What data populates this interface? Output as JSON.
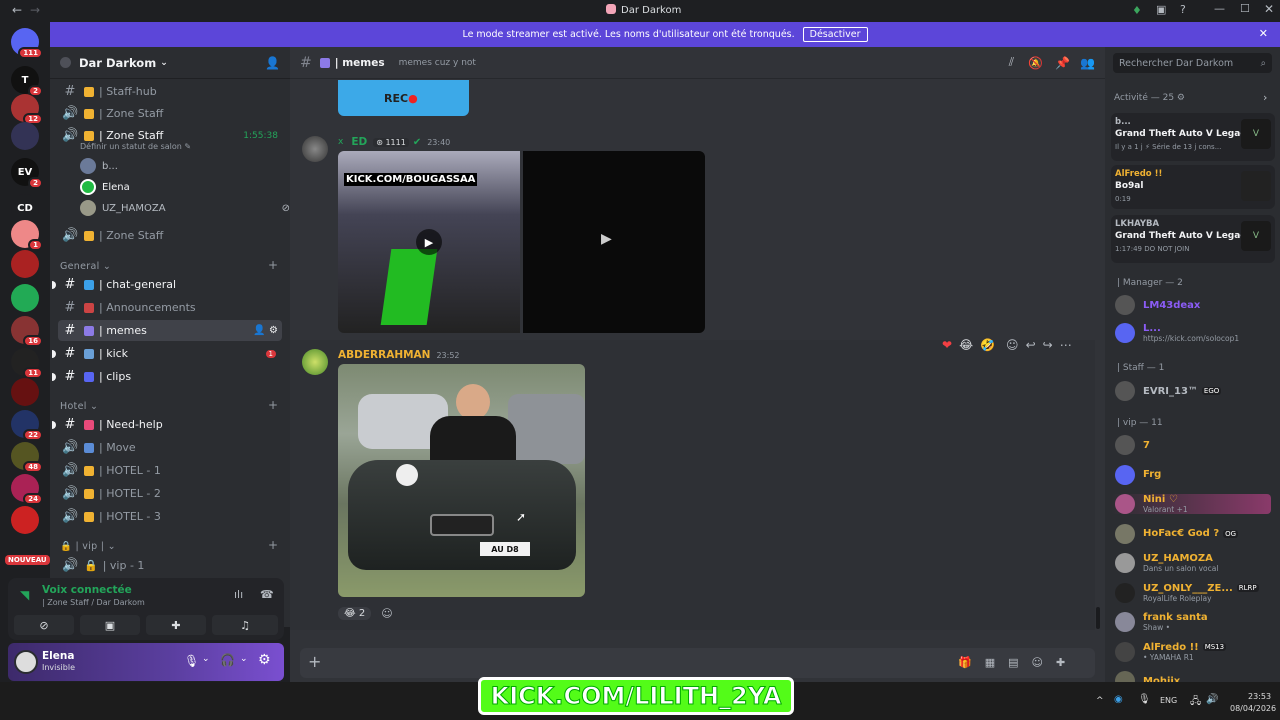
{
  "window": {
    "title": "Dar Darkom"
  },
  "banner": {
    "text": "Le mode streamer est activé. Les noms d'utilisateur ont été tronqués.",
    "button": "Désactiver"
  },
  "guilds": [
    {
      "label": "",
      "badge": "111",
      "color": "#5865f2"
    },
    {
      "label": "T",
      "badge": "2",
      "color": "#111"
    },
    {
      "label": "",
      "badge": "12",
      "color": "#a33"
    },
    {
      "label": "",
      "badge": "",
      "color": "#335"
    },
    {
      "label": "EV",
      "badge": "2",
      "color": "#111"
    },
    {
      "label": "CD",
      "badge": "",
      "color": "#1e1f22"
    },
    {
      "label": "",
      "badge": "1",
      "color": "#e88"
    },
    {
      "label": "",
      "badge": "",
      "color": "#a22"
    },
    {
      "label": "",
      "badge": "",
      "color": "#2a5"
    },
    {
      "label": "",
      "badge": "16",
      "color": "#833"
    },
    {
      "label": "",
      "badge": "11",
      "color": "#222"
    },
    {
      "label": "",
      "badge": "",
      "color": "#611"
    },
    {
      "label": "",
      "badge": "22",
      "color": "#236"
    },
    {
      "label": "",
      "badge": "48",
      "color": "#552"
    },
    {
      "label": "",
      "badge": "24",
      "color": "#a25"
    },
    {
      "label": "",
      "badge": "",
      "color": "#c22"
    }
  ],
  "guild_new": "NOUVEAU",
  "server": {
    "name": "Dar Darkom"
  },
  "channels_top": [
    {
      "name": "| Staff-hub",
      "type": "text"
    },
    {
      "name": "| Zone Staff",
      "type": "voice"
    },
    {
      "name": "| Zone Staff",
      "type": "voice",
      "active": true,
      "time": "1:55:38",
      "status": "Définir un statut de salon"
    }
  ],
  "voice_users": [
    {
      "name": "b..."
    },
    {
      "name": "Elena"
    },
    {
      "name": "UZ_HAMOZA"
    }
  ],
  "channel_after_voice": "| Zone Staff",
  "category_general": "General",
  "channels_general": [
    {
      "name": "| chat-general",
      "unread": true
    },
    {
      "name": "| Announcements"
    },
    {
      "name": "| memes",
      "active": true
    },
    {
      "name": "| kick",
      "unread": true,
      "badge": "1"
    },
    {
      "name": "| clips",
      "unread": true
    }
  ],
  "category_hotel": "Hotel",
  "channels_hotel": [
    {
      "name": "| Need-help",
      "unread": true,
      "type": "text"
    },
    {
      "name": "| Move",
      "type": "voice"
    },
    {
      "name": "| HOTEL - 1",
      "type": "voice"
    },
    {
      "name": "| HOTEL - 2",
      "type": "voice"
    },
    {
      "name": "| HOTEL - 3",
      "type": "voice"
    }
  ],
  "category_vip": "| vip |",
  "channels_vip": [
    {
      "name": "| vip - 1"
    }
  ],
  "voice_connected": {
    "title": "Voix connectée",
    "location": "| Zone Staff / Dar Darkom"
  },
  "user": {
    "name": "Elena",
    "status": "Invisible"
  },
  "chat": {
    "channel": "| memes",
    "topic": "memes cuz y not",
    "messages": [
      {
        "author": "ED",
        "tag": "1111",
        "time": "23:40",
        "media_text": "KICK.COM/BOUGASSAA"
      },
      {
        "author": "ABDERRAHMAN",
        "time": "23:52",
        "reaction_count": "2"
      }
    ],
    "plate": "AU D8"
  },
  "search": {
    "placeholder": "Rechercher Dar Darkom"
  },
  "members": {
    "activity_header": "Activité — 25",
    "activities": [
      {
        "name": "b...",
        "game": "Grand Theft Auto V Legacy",
        "detail": "Il y a 1 j  ⚡ Série de 13 j cons..."
      },
      {
        "name": "AlFredo !!",
        "game": "Bo9al",
        "detail": "0:19"
      },
      {
        "name": "LKHAYBA",
        "game": "Grand Theft Auto V Legacy",
        "detail": "1:17:49  DO NOT JOIN"
      }
    ],
    "manager_header": "| Manager — 2",
    "manager": [
      {
        "name": "LM43deax",
        "sub": "",
        "color": "#8b5cf6"
      },
      {
        "name": "L...",
        "sub": "https://kick.com/solocop1",
        "color": "#8b5cf6"
      }
    ],
    "staff_header": "| Staff — 1",
    "staff": [
      {
        "name": "EVRI_13™",
        "tag": "EGO",
        "color": "#b5bac1"
      }
    ],
    "vip_header": "| vip — 11",
    "vip": [
      {
        "name": "7",
        "sub": "",
        "color": "#f0b232"
      },
      {
        "name": "Frg",
        "sub": "",
        "color": "#f0b232"
      },
      {
        "name": "Nini ♡",
        "sub": "Valorant +1",
        "color": "#f0b232"
      },
      {
        "name": "HoFac€ God ?",
        "tag": "OG",
        "sub": "",
        "color": "#f0b232"
      },
      {
        "name": "UZ_HAMOZA",
        "sub": "Dans un salon vocal",
        "color": "#f0b232"
      },
      {
        "name": "UZ_ONLY___ZE...",
        "tag": "RLRP",
        "sub": "RoyalLife Roleplay",
        "color": "#f0b232"
      },
      {
        "name": "frank santa",
        "sub": "Shaw •",
        "color": "#f0b232"
      },
      {
        "name": "AlFredo !!",
        "tag": "MS13",
        "sub": "• YAMAHA R1",
        "color": "#f0b232"
      },
      {
        "name": "Mohiix",
        "sub": "",
        "color": "#f0b232"
      }
    ]
  },
  "overlay": {
    "text": "KICK.COM/LILITH_2YA"
  },
  "taskbar": {
    "lang": "ENG",
    "time": "23:53",
    "date": "08/04/2026"
  }
}
